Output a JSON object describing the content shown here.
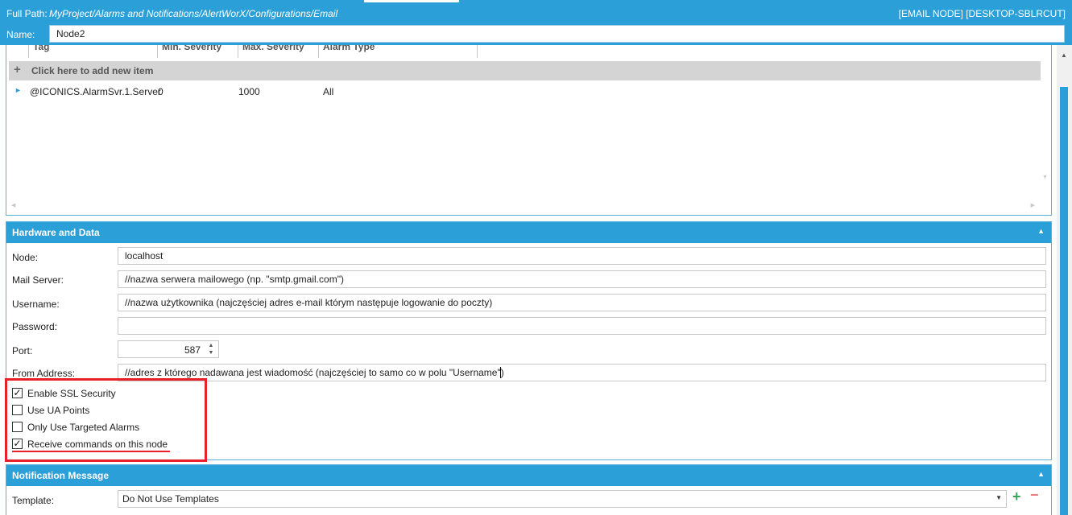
{
  "header": {
    "full_path_label": "Full Path:",
    "full_path_value": "MyProject/Alarms and Notifications/AlertWorX/Configurations/Email",
    "node_identity": "[EMAIL NODE] [DESKTOP-SBLRCUT]",
    "name_label": "Name:",
    "name_value": "Node2"
  },
  "grid": {
    "columns": [
      "Tag",
      "Min. Severity",
      "Max. Severity",
      "Alarm Type"
    ],
    "add_row_text": "Click here to add new item",
    "add_row_icon": "plus-icon",
    "rows": [
      {
        "tag": "@ICONICS.AlarmSvr.1.Server",
        "min_severity": "0",
        "max_severity": "1000",
        "alarm_type": "All"
      }
    ]
  },
  "hardware": {
    "title": "Hardware and Data",
    "node_label": "Node:",
    "node_value": "localhost",
    "mail_server_label": "Mail Server:",
    "mail_server_value": "//nazwa serwera mailowego (np. \"smtp.gmail.com\")",
    "username_label": "Username:",
    "username_value": "//nazwa użytkownika (najczęściej adres e-mail którym następuje logowanie do poczty)",
    "password_label": "Password:",
    "password_value": "",
    "port_label": "Port:",
    "port_value": "587",
    "from_label": "From Address:",
    "from_value": "//adres z którego nadawana jest wiadomość (najczęściej to samo co w polu \"Username\")",
    "checks": [
      {
        "label": "Enable SSL Security",
        "checked": true
      },
      {
        "label": "Use UA Points",
        "checked": false
      },
      {
        "label": "Only Use Targeted Alarms",
        "checked": false
      },
      {
        "label": "Receive commands on this node",
        "checked": true
      }
    ]
  },
  "notification": {
    "title": "Notification Message",
    "template_label": "Template:",
    "template_value": "Do Not Use Templates"
  },
  "colors": {
    "accent": "#2a9fd8",
    "highlight": "#e8202a",
    "add_green": "#3aa55a",
    "remove_red": "#e87a7a"
  }
}
